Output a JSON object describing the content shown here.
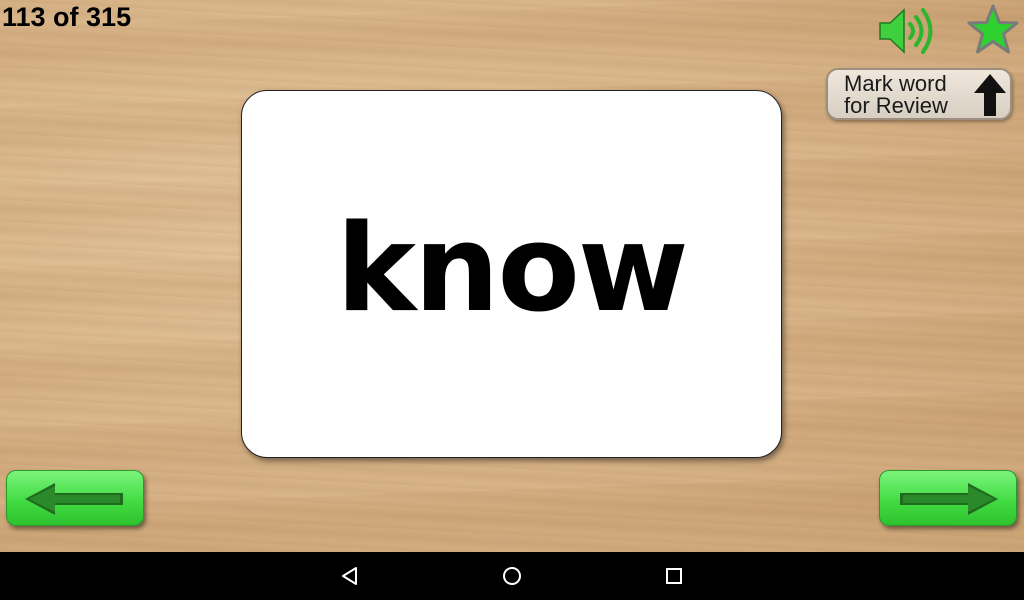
{
  "header": {
    "progress_text": "113 of 315"
  },
  "toolbar": {
    "speaker_icon": "speaker-icon",
    "star_icon": "star-icon",
    "review_button_label": "Mark word for Review",
    "review_arrow_icon": "up-arrow-icon"
  },
  "card": {
    "word": "know"
  },
  "navigation": {
    "prev_icon": "left-arrow-icon",
    "next_icon": "right-arrow-icon"
  },
  "system_bar": {
    "back_icon": "back-triangle-icon",
    "home_icon": "home-circle-icon",
    "recents_icon": "recents-square-icon"
  },
  "colors": {
    "accent_green": "#3fd93f",
    "card_bg": "#ffffff",
    "wood_bg": "#d6b185"
  }
}
